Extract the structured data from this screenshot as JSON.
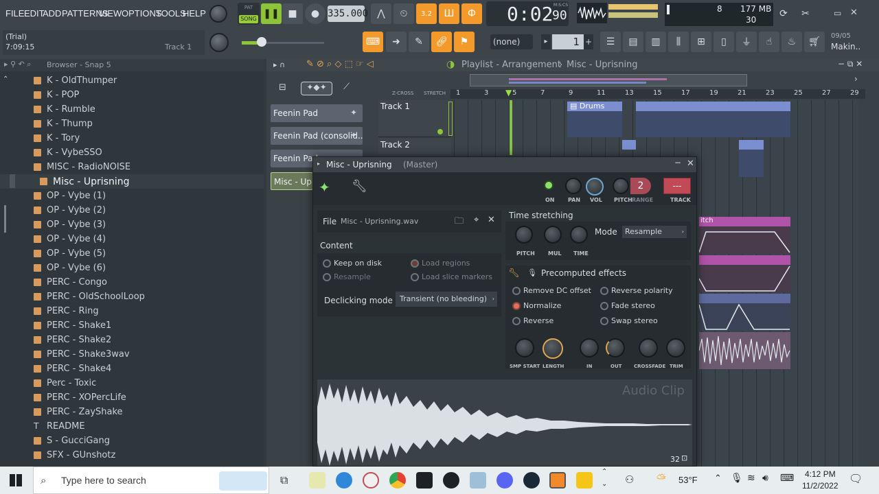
{
  "menu": [
    "FILE",
    "EDIT",
    "ADD",
    "PATTERNS",
    "VIEW",
    "OPTIONS",
    "TOOLS",
    "HELP"
  ],
  "transport": {
    "pat_label": "PAT",
    "song_label": "SONG",
    "tempo": "335.000",
    "time": "0:02",
    "time_small": "90",
    "time_format": "M:S:CS",
    "pattern": "1"
  },
  "hint": {
    "line1": "(Trial)",
    "line2": "7:09:15",
    "track": "Track 1"
  },
  "cpu": {
    "voices": "8",
    "memory": "177 MB",
    "polyphony": "30"
  },
  "news": {
    "date": "09/05",
    "text": "Makin.."
  },
  "snap_select": "(none)",
  "browser": {
    "title": "Browser - Snap 5",
    "items": [
      "K - OldThumper",
      "K - POP",
      "K - Rumble",
      "K - Thump",
      "K - Tory",
      "K - VybeSSO",
      "MISC - RadioNOISE",
      "Misc - Uprisning",
      "OP - Vybe (1)",
      "OP - Vybe (2)",
      "OP - Vybe (3)",
      "OP - Vybe (4)",
      "OP - Vybe (5)",
      "OP - Vybe (6)",
      "PERC - Congo",
      "PERC - OldSchoolLoop",
      "PERC - Ring",
      "PERC - Shake1",
      "PERC - Shake2",
      "PERC - Shake3wav",
      "PERC - Shake4",
      "Perc - Toxic",
      "PERC - XOPercLife",
      "PERC - ZayShake",
      "README",
      "S - GucciGang",
      "SFX - GUnshotz"
    ]
  },
  "playlist": {
    "title": "Playlist - Arrangement",
    "pattern": "Misc - Uprisning",
    "zcross": "Z-CROSS",
    "stretch": "STRETCH",
    "tracks": [
      "Track 1",
      "Track 2"
    ],
    "patterns": [
      "Feenin Pad",
      "Feenin Pad (consolid..",
      "Feenin Pad",
      "Misc - Upri"
    ],
    "ruler": [
      "1",
      "3",
      "5",
      "7",
      "9",
      "11",
      "13",
      "15",
      "17",
      "19",
      "21",
      "23",
      "25",
      "27",
      "29"
    ],
    "clip_drums": "Drums",
    "clip_pitch": "itch"
  },
  "dialog": {
    "title": "Misc - Uprisning",
    "title_suffix": "(Master)",
    "knob_labels": [
      "ON",
      "PAN",
      "VOL",
      "PITCH",
      "RANGE",
      "TRACK"
    ],
    "pitch_range": "2",
    "track_value": "---",
    "file_label": "File",
    "file_name": "Misc - Uprisning.wav",
    "content_header": "Content",
    "keep_on_disk": "Keep on disk",
    "resample": "Resample",
    "load_regions": "Load regions",
    "load_slice_markers": "Load slice markers",
    "declicking_label": "Declicking mode",
    "declicking_value": "Transient (no bleeding)",
    "time_stretching": "Time stretching",
    "ts_knobs": [
      "PITCH",
      "MUL",
      "TIME"
    ],
    "mode_label": "Mode",
    "mode_value": "Resample",
    "precomputed": "Precomputed effects",
    "effects": [
      "Remove DC offset",
      "Normalize",
      "Reverse",
      "Reverse polarity",
      "Fade stereo",
      "Swap stereo"
    ],
    "effect_knobs": [
      "SMP START",
      "LENGTH",
      "IN",
      "OUT",
      "CROSSFADE",
      "TRIM"
    ],
    "watermark": "Audio Clip",
    "zoom": "32"
  },
  "taskbar": {
    "search_placeholder": "Type here to search",
    "weather": "53°F",
    "time": "4:12 PM",
    "date": "11/2/2022"
  }
}
